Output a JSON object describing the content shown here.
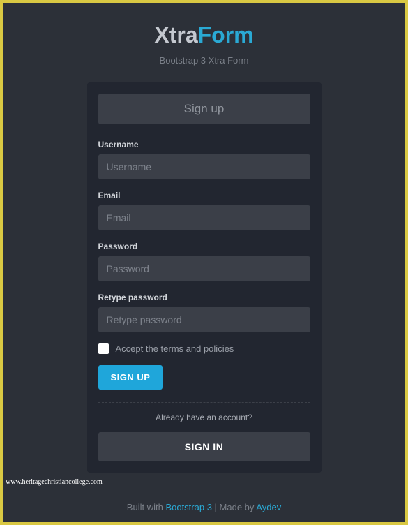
{
  "brand": {
    "part1": "Xtra",
    "part2": "Form"
  },
  "tagline": "Bootstrap 3 Xtra Form",
  "form": {
    "header": "Sign up",
    "username": {
      "label": "Username",
      "placeholder": "Username",
      "value": ""
    },
    "email": {
      "label": "Email",
      "placeholder": "Email",
      "value": ""
    },
    "password": {
      "label": "Password",
      "placeholder": "Password",
      "value": ""
    },
    "retype": {
      "label": "Retype password",
      "placeholder": "Retype password",
      "value": ""
    },
    "terms_label": "Accept the terms and policies",
    "signup_button": "SIGN UP",
    "already_text": "Already have an account?",
    "signin_button": "SIGN IN"
  },
  "watermark": "www.heritagechristiancollege.com",
  "footer": {
    "prefix": "Built with ",
    "link1": "Bootstrap 3",
    "middle": " | Made by ",
    "link2": "Aydev"
  }
}
